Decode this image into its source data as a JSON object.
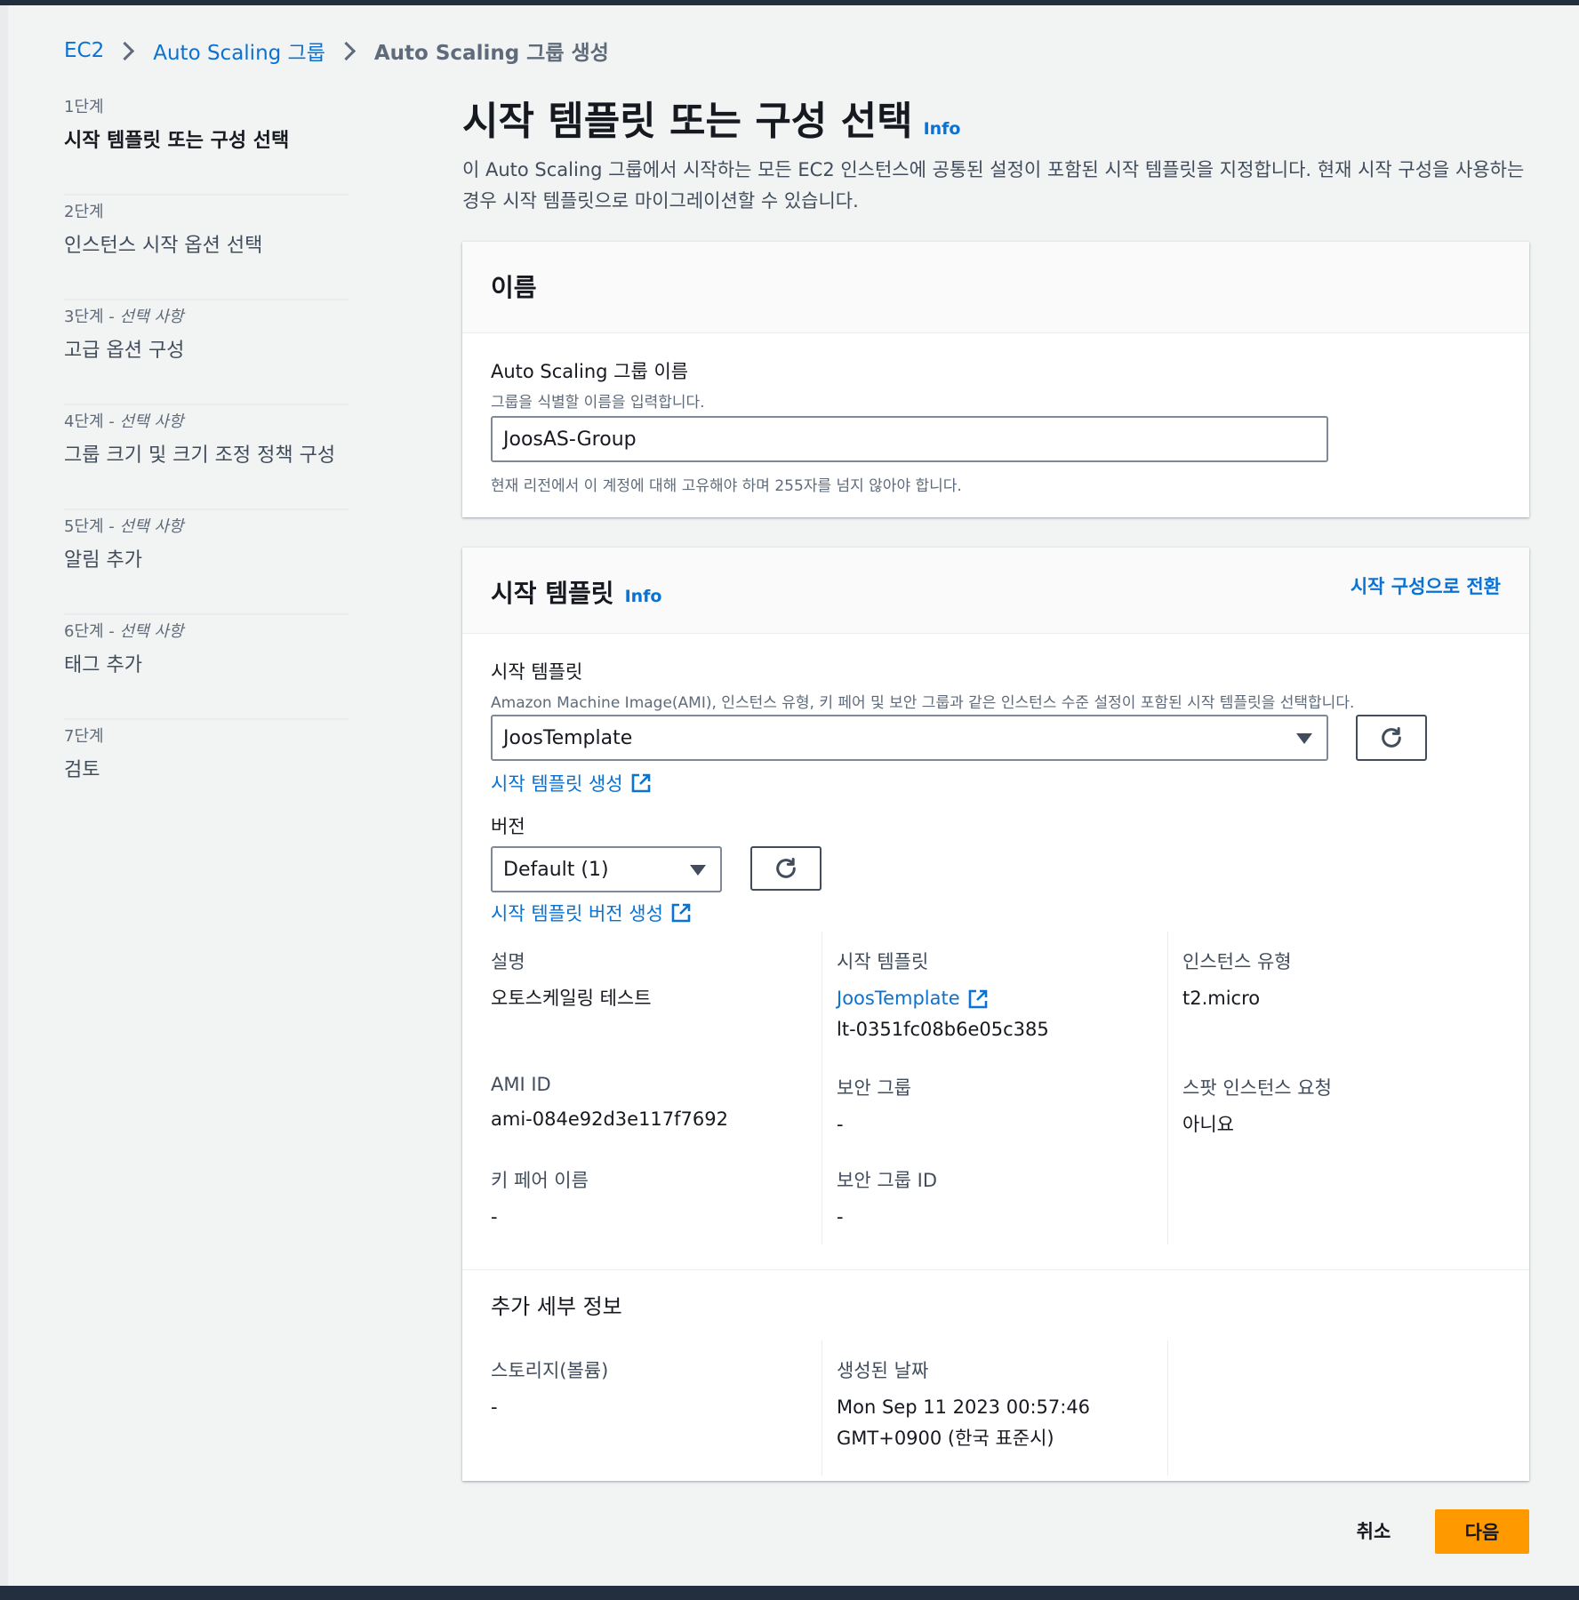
{
  "breadcrumb": {
    "items": [
      "EC2",
      "Auto Scaling 그룹"
    ],
    "current": "Auto Scaling 그룹 생성"
  },
  "nav": {
    "steps": [
      {
        "label": "1단계",
        "optional": "",
        "title": "시작 템플릿 또는 구성 선택"
      },
      {
        "label": "2단계",
        "optional": "",
        "title": "인스턴스 시작 옵션 선택"
      },
      {
        "label": "3단계 - ",
        "optional": "선택 사항",
        "title": "고급 옵션 구성"
      },
      {
        "label": "4단계 - ",
        "optional": "선택 사항",
        "title": "그룹 크기 및 크기 조정 정책 구성"
      },
      {
        "label": "5단계 - ",
        "optional": "선택 사항",
        "title": "알림 추가"
      },
      {
        "label": "6단계 - ",
        "optional": "선택 사항",
        "title": "태그 추가"
      },
      {
        "label": "7단계",
        "optional": "",
        "title": "검토"
      }
    ]
  },
  "header": {
    "title": "시작 템플릿 또는 구성 선택",
    "info": "Info",
    "description": "이 Auto Scaling 그룹에서 시작하는 모든 EC2 인스턴스에 공통된 설정이 포함된 시작 템플릿을 지정합니다. 현재 시작 구성을 사용하는 경우 시작 템플릿으로 마이그레이션할 수 있습니다."
  },
  "name_panel": {
    "title": "이름",
    "field_label": "Auto Scaling 그룹 이름",
    "field_desc": "그룹을 식별할 이름을 입력합니다.",
    "field_value": "JoosAS-Group",
    "constraint": "현재 리전에서 이 계정에 대해 고유해야 하며 255자를 넘지 않아야 합니다."
  },
  "template_panel": {
    "title": "시작 템플릿",
    "info": "Info",
    "switch_link": "시작 구성으로 전환",
    "template_label": "시작 템플릿",
    "template_desc": "Amazon Machine Image(AMI), 인스턴스 유형, 키 페어 및 보안 그룹과 같은 인스턴스 수준 설정이 포함된 시작 템플릿을 선택합니다.",
    "template_value": "JoosTemplate",
    "create_template_link": "시작 템플릿 생성",
    "version_label": "버전",
    "version_value": "Default (1)",
    "create_version_link": "시작 템플릿 버전 생성",
    "details": {
      "desc_key": "설명",
      "desc_val": "오토스케일링 테스트",
      "template_key": "시작 템플릿",
      "template_link": "JoosTemplate",
      "template_id": "lt-0351fc08b6e05c385",
      "type_key": "인스턴스 유형",
      "type_val": "t2.micro",
      "ami_key": "AMI ID",
      "ami_val": "ami-084e92d3e117f7692",
      "sg_key": "보안 그룹",
      "sg_val": "-",
      "spot_key": "스팟 인스턴스 요청",
      "spot_val": "아니요",
      "keypair_key": "키 페어 이름",
      "keypair_val": "-",
      "sgid_key": "보안 그룹 ID",
      "sgid_val": "-"
    },
    "additional": {
      "title": "추가 세부 정보",
      "storage_key": "스토리지(볼륨)",
      "storage_val": "-",
      "created_key": "생성된 날짜",
      "created_val_1": "Mon Sep 11 2023 00:57:46",
      "created_val_2": "GMT+0900 (한국 표준시)"
    }
  },
  "footer": {
    "cancel": "취소",
    "next": "다음"
  },
  "colors": {
    "accent": "#0972d3",
    "primary_button": "#ff9900",
    "topbar": "#232f3e"
  },
  "icons": [
    "chevron-right-icon",
    "external-link-icon",
    "refresh-icon",
    "caret-down-icon"
  ]
}
